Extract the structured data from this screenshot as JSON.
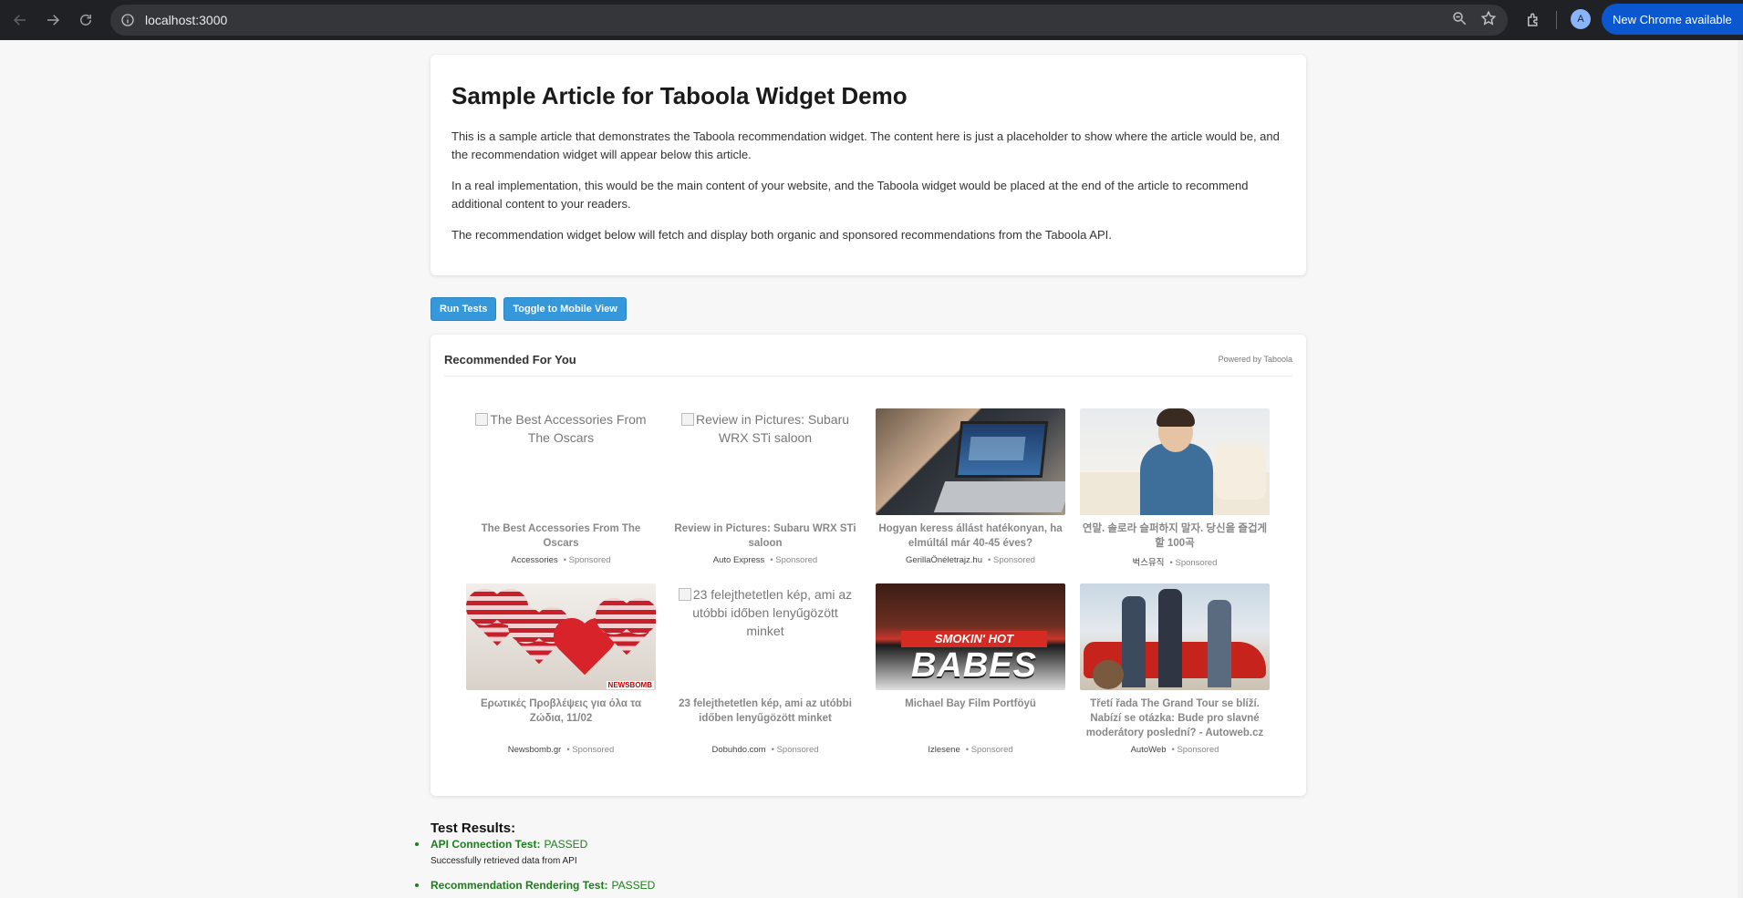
{
  "browser": {
    "url": "localhost:3000",
    "avatar_letter": "A",
    "update_label": "New Chrome available"
  },
  "article": {
    "title": "Sample Article for Taboola Widget Demo",
    "paragraphs": [
      "This is a sample article that demonstrates the Taboola recommendation widget. The content here is just a placeholder to show where the article would be, and the recommendation widget will appear below this article.",
      "In a real implementation, this would be the main content of your website, and the Taboola widget would be placed at the end of the article to recommend additional content to your readers.",
      "The recommendation widget below will fetch and display both organic and sponsored recommendations from the Taboola API."
    ]
  },
  "controls": {
    "run_tests": "Run Tests",
    "toggle_view": "Toggle to Mobile View"
  },
  "widget": {
    "title": "Recommended For You",
    "powered_by": "Powered by Taboola",
    "items": [
      {
        "alt": "The Best Accessories From The Oscars",
        "title": "The Best Accessories From The Oscars",
        "source": "Accessories",
        "label": "• Sponsored",
        "image": "broken"
      },
      {
        "alt": "Review in Pictures: Subaru WRX STi saloon",
        "title": "Review in Pictures: Subaru WRX STi saloon",
        "source": "Auto Express",
        "label": "• Sponsored",
        "image": "broken"
      },
      {
        "alt": "",
        "title": "Hogyan keress állást hatékonyan, ha elmúltál már 40-45 éves?",
        "source": "GerillaÖnéletrajz.hu",
        "label": "• Sponsored",
        "image": "laptop-photo"
      },
      {
        "alt": "",
        "title": "연말. 솔로라 슬퍼하지 말자. 당신을 즐겁게 할 100곡",
        "source": "벅스뮤직",
        "label": "• Sponsored",
        "image": "man-sofa-photo"
      },
      {
        "alt": "",
        "title": "Ερωτικές Προβλέψεις για όλα τα Ζώδια, 11/02",
        "source": "Newsbomb.gr",
        "label": "• Sponsored",
        "image": "hearts-photo",
        "image_text": "NEWSBOMB"
      },
      {
        "alt": "23 felejthetetlen kép, ami az utóbbi időben lenyűgözött minket",
        "title": "23 felejthetetlen kép, ami az utóbbi időben lenyűgözött minket",
        "source": "Dobuhdo.com",
        "label": "• Sponsored",
        "image": "broken"
      },
      {
        "alt": "",
        "title": "Michael Bay Film Portföyü",
        "source": "Izlesene",
        "label": "• Sponsored",
        "image": "smokin-hot-babes-poster",
        "image_text_1": "SMOKIN' HOT",
        "image_text_2": "BABES"
      },
      {
        "alt": "",
        "title": "Třetí řada The Grand Tour se blíží. Nabízí se otázka: Bude pro slavné moderátory poslední? - Autoweb.cz",
        "source": "AutoWeb",
        "label": "• Sponsored",
        "image": "three-men-car-photo"
      }
    ]
  },
  "results": {
    "heading": "Test Results:",
    "items": [
      {
        "name": "API Connection Test:",
        "status": "PASSED",
        "detail": "Successfully retrieved data from API"
      },
      {
        "name": "Recommendation Rendering Test:",
        "status": "PASSED",
        "detail": ""
      }
    ]
  },
  "colors": {
    "accent_button": "#3498db",
    "pass_green": "#1b7f1b",
    "chrome_bg": "#202124",
    "update_blue": "#0b57d0"
  }
}
